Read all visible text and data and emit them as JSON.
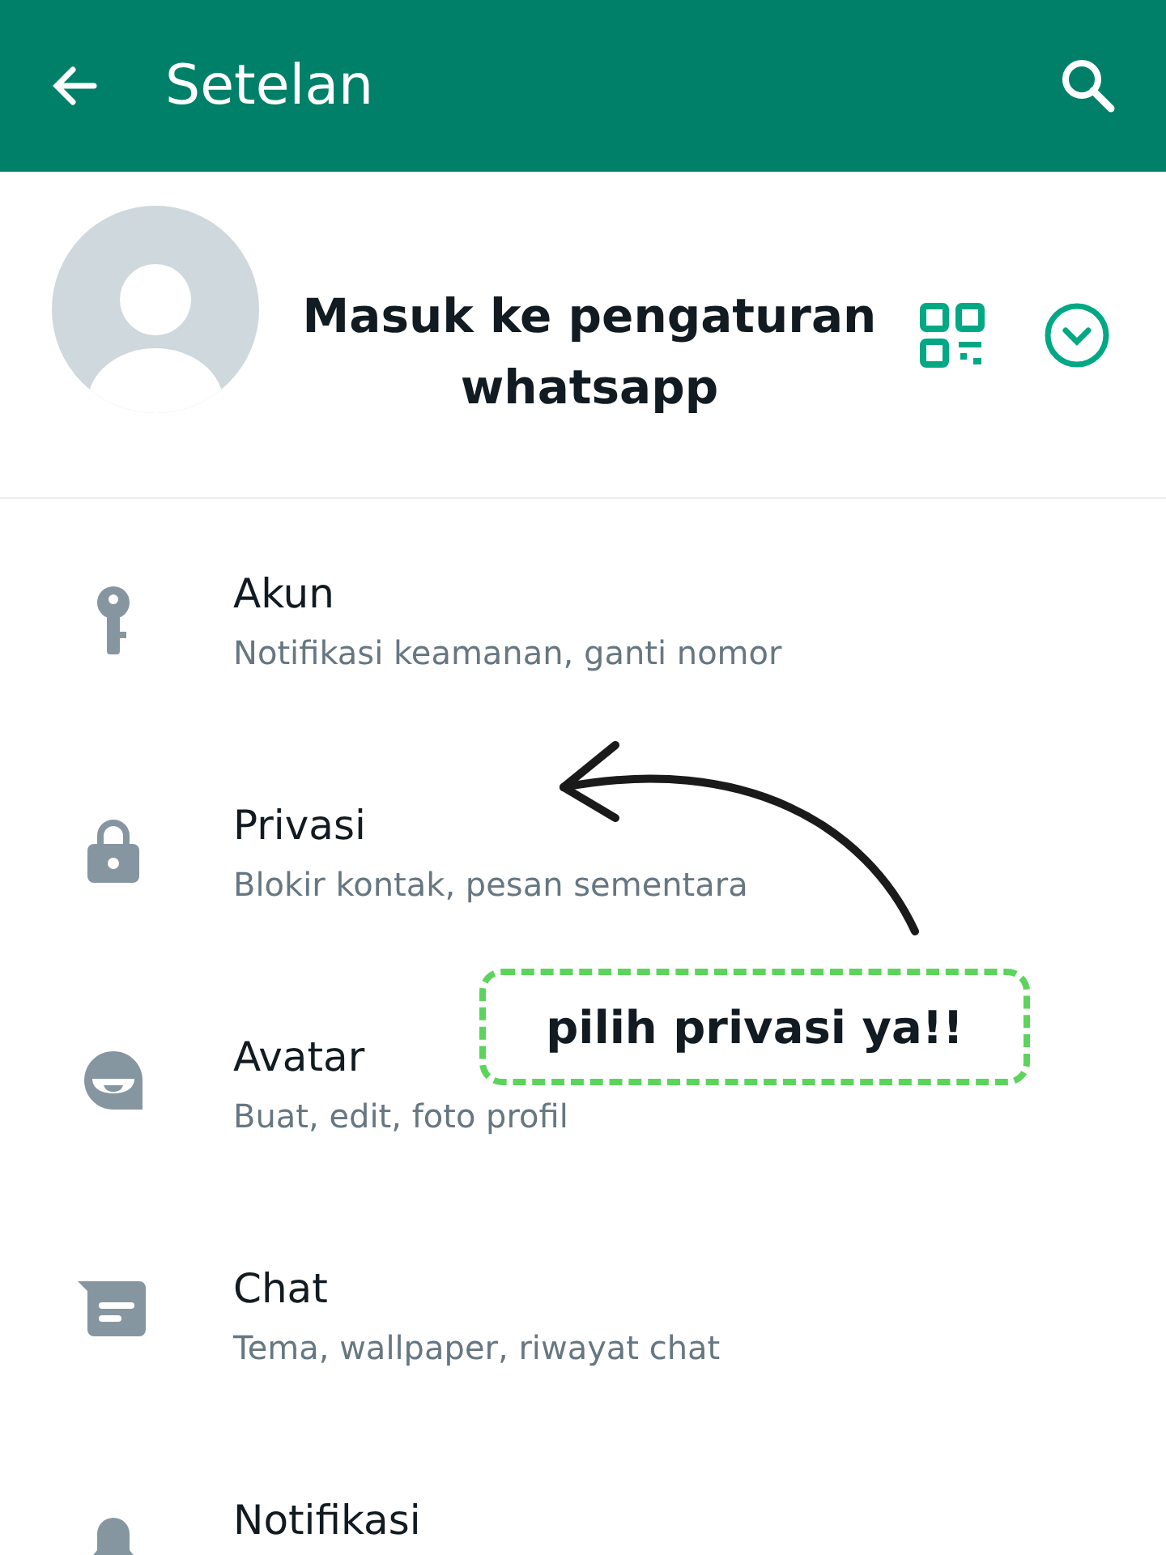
{
  "header": {
    "title": "Setelan"
  },
  "profile": {
    "annotation_lines": [
      "Masuk ke pengaturan",
      "whatsapp"
    ]
  },
  "settings": [
    {
      "kind": "key",
      "title": "Akun",
      "subtitle": "Notifikasi keamanan, ganti nomor"
    },
    {
      "kind": "lock",
      "title": "Privasi",
      "subtitle": "Blokir kontak, pesan sementara"
    },
    {
      "kind": "avatar",
      "title": "Avatar",
      "subtitle": "Buat, edit, foto profil"
    },
    {
      "kind": "chat",
      "title": "Chat",
      "subtitle": "Tema, wallpaper, riwayat chat"
    },
    {
      "kind": "bell",
      "title": "Notifikasi"
    }
  ],
  "callout": {
    "text": "pilih privasi ya!!"
  }
}
